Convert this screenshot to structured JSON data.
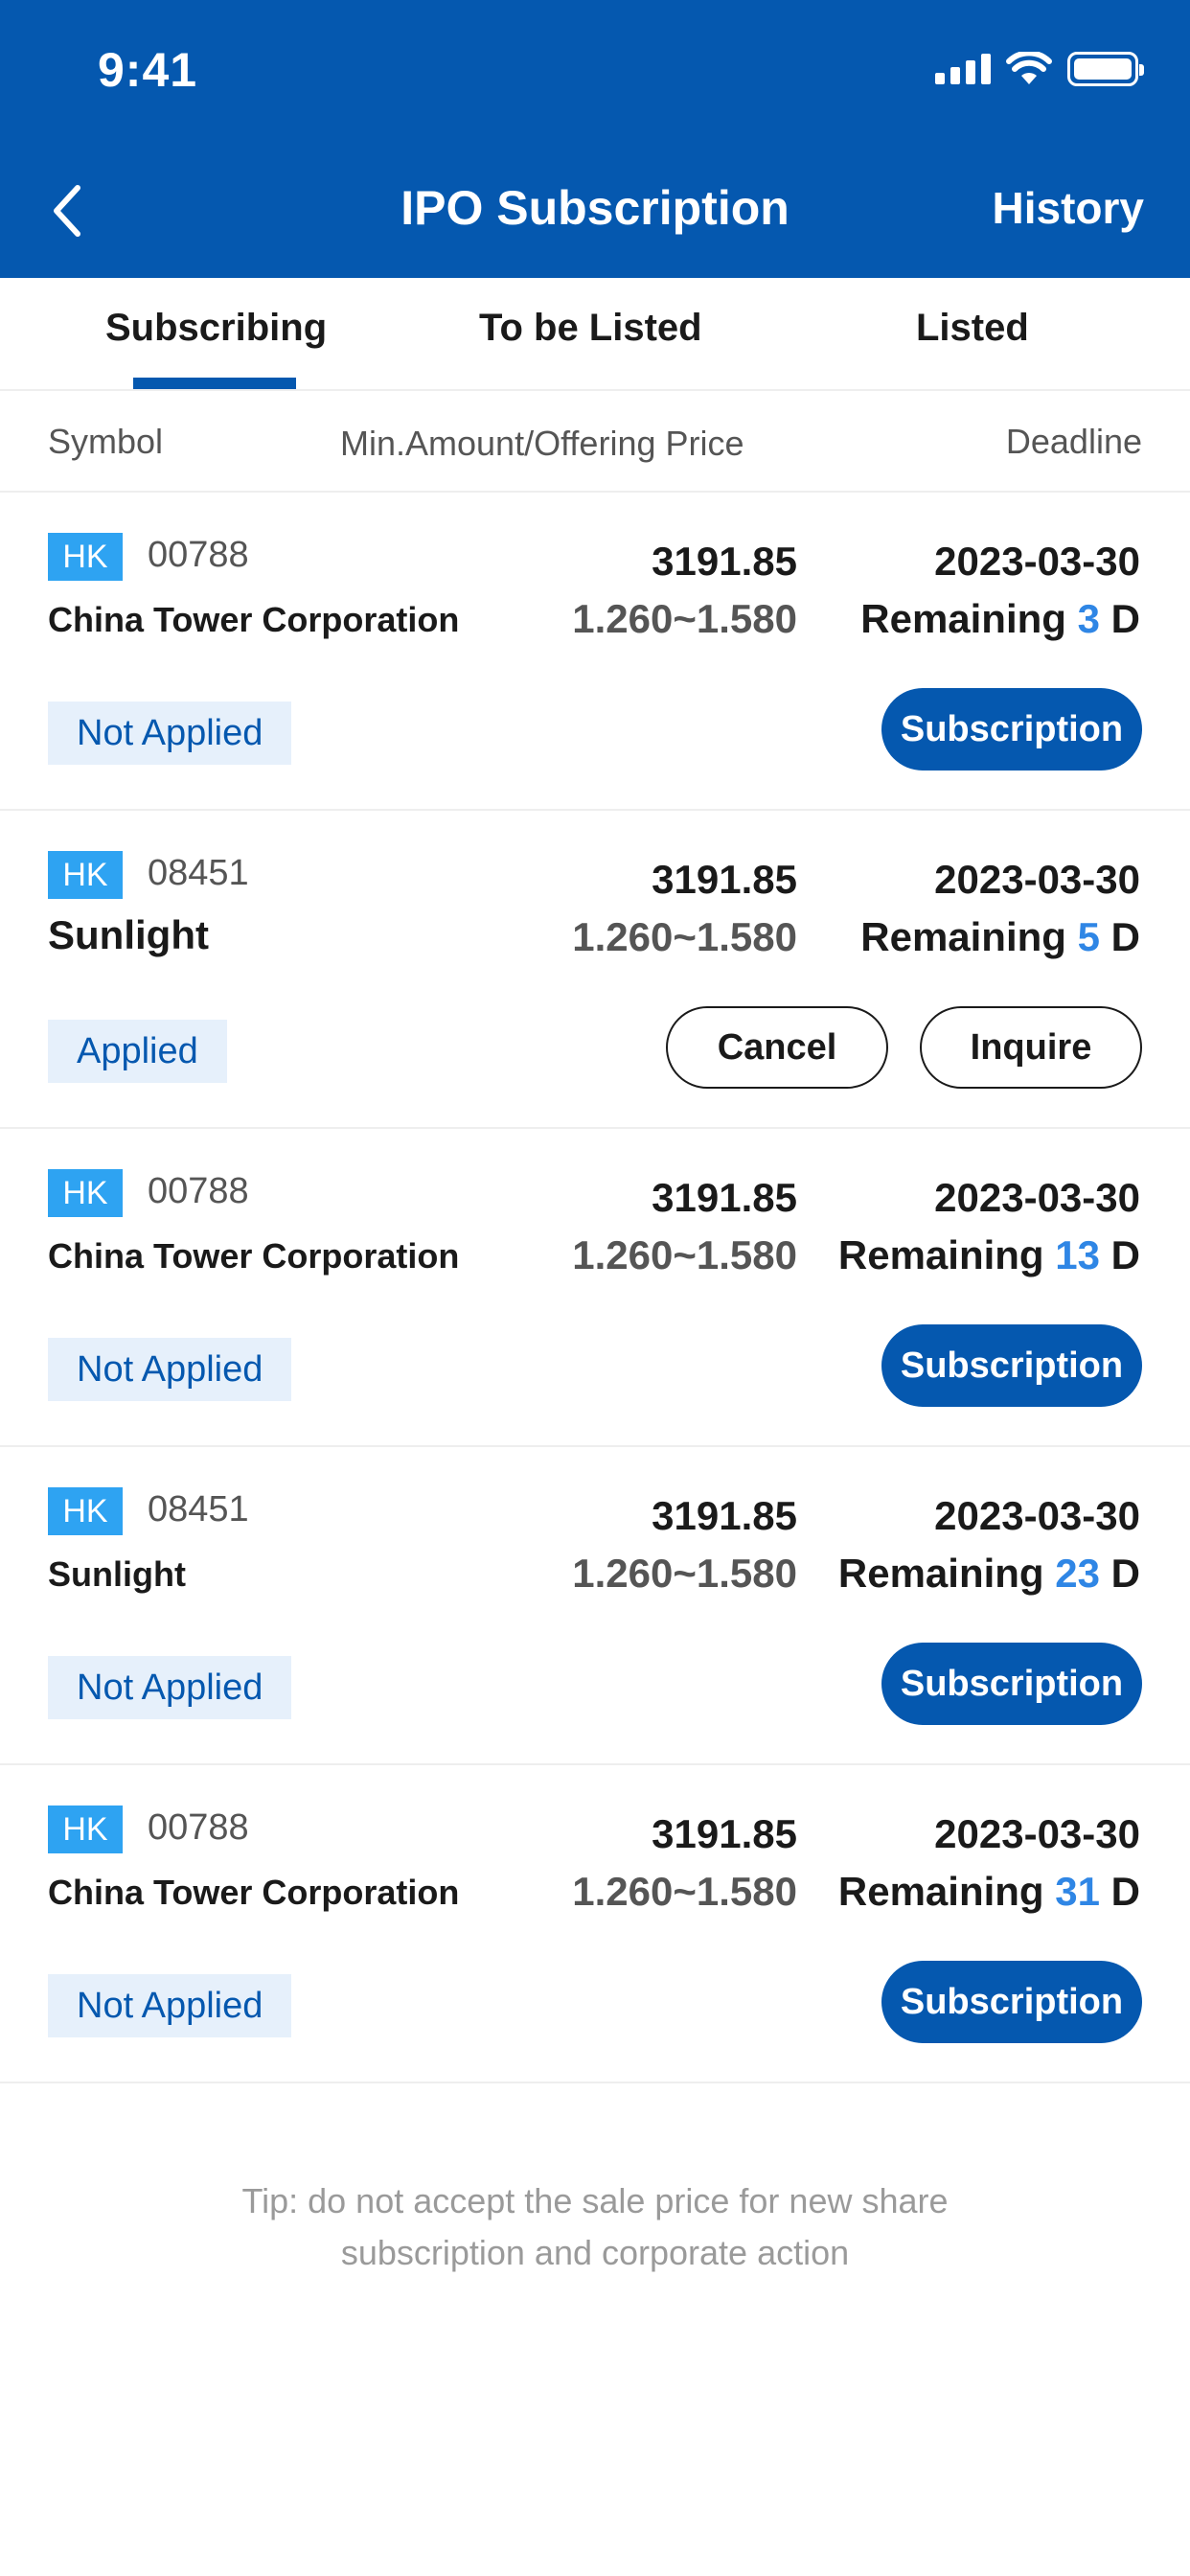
{
  "status_bar": {
    "time": "9:41"
  },
  "header": {
    "title": "IPO Subscription",
    "history_label": "History"
  },
  "tabs": [
    {
      "label": "Subscribing",
      "active": true
    },
    {
      "label": "To be Listed",
      "active": false
    },
    {
      "label": "Listed",
      "active": false
    }
  ],
  "columns": {
    "symbol": "Symbol",
    "price": "Min.Amount/Offering Price",
    "deadline": "Deadline"
  },
  "rows": [
    {
      "market": "HK",
      "code": "00788",
      "name": "China Tower Corporation",
      "min_amount": "3191.85",
      "price_range": "1.260~1.580",
      "deadline": "2023-03-30",
      "remaining_prefix": "Remaining",
      "remaining_days": "3",
      "remaining_unit": "D",
      "status": "Not Applied",
      "action": "Subscription"
    },
    {
      "market": "HK",
      "code": "08451",
      "name": "Sunlight",
      "min_amount": "3191.85",
      "price_range": "1.260~1.580",
      "deadline": "2023-03-30",
      "remaining_prefix": "Remaining",
      "remaining_days": "5",
      "remaining_unit": "D",
      "status": "Applied",
      "cancel_label": "Cancel",
      "inquire_label": "Inquire"
    },
    {
      "market": "HK",
      "code": "00788",
      "name": "China Tower Corporation",
      "min_amount": "3191.85",
      "price_range": "1.260~1.580",
      "deadline": "2023-03-30",
      "remaining_prefix": "Remaining",
      "remaining_days": "13",
      "remaining_unit": "D",
      "status": "Not Applied",
      "action": "Subscription"
    },
    {
      "market": "HK",
      "code": "08451",
      "name": "Sunlight",
      "min_amount": "3191.85",
      "price_range": "1.260~1.580",
      "deadline": "2023-03-30",
      "remaining_prefix": "Remaining",
      "remaining_days": "23",
      "remaining_unit": "D",
      "status": "Not Applied",
      "action": "Subscription"
    },
    {
      "market": "HK",
      "code": "00788",
      "name": "China Tower Corporation",
      "min_amount": "3191.85",
      "price_range": "1.260~1.580",
      "deadline": "2023-03-30",
      "remaining_prefix": "Remaining",
      "remaining_days": "31",
      "remaining_unit": "D",
      "status": "Not Applied",
      "action": "Subscription"
    }
  ],
  "tip": {
    "line1": "Tip: do not accept the sale price for new share",
    "line2": "subscription and corporate action"
  },
  "colors": {
    "brand": "#0558AF",
    "accent": "#2EA3F2",
    "remaining_highlight": "#2F86E5"
  }
}
